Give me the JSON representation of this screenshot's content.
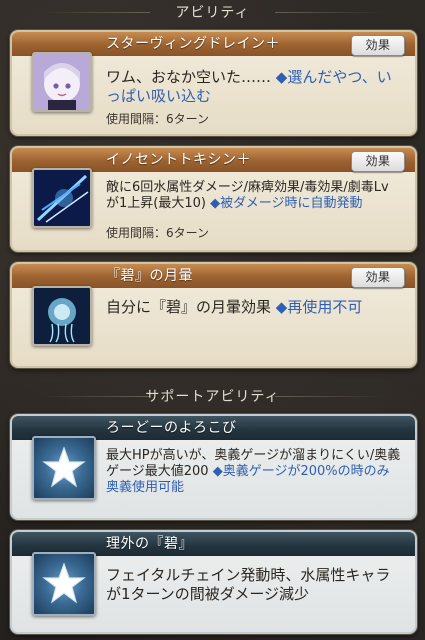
{
  "sections": {
    "abilities_title": "アビリティ",
    "support_title": "サポートアビリティ"
  },
  "abilities": [
    {
      "name": "スターヴィングドレイン＋",
      "badge": "効果",
      "desc_main": "ワム、おなか空いた……",
      "desc_hl": "◆選んだやつ、いっぱい吸い込む",
      "cooldown": "使用間隔：6ターン",
      "icon": "chibi-character-icon"
    },
    {
      "name": "イノセントトキシン＋",
      "badge": "効果",
      "desc_main": "敵に6回水属性ダメージ/麻痺効果/毒効果/劇毒Lvが1上昇(最大10)",
      "desc_hl": "◆被ダメージ時に自動発動",
      "cooldown": "使用間隔：6ターン",
      "icon": "water-slash-icon"
    },
    {
      "name": "『碧』の月暈",
      "badge": "効果",
      "desc_main": "自分に『碧』の月暈効果",
      "desc_hl": "◆再使用不可",
      "icon": "jellyfish-icon"
    }
  ],
  "supports": [
    {
      "name": "ろーどーのよろこび",
      "desc_main": "最大HPが高いが、奥義ゲージが溜まりにくい/奥義ゲージ最大値200",
      "desc_hl": "◆奥義ゲージが200%の時のみ奥義使用可能",
      "icon": "star-icon"
    },
    {
      "name": "理外の『碧』",
      "desc_main": "フェイタルチェイン発動時、水属性キャラが1ターンの間被ダメージ減少",
      "icon": "star-icon"
    }
  ],
  "colors": {
    "ability_header": "#9c6230",
    "support_header": "#253640",
    "highlight_text": "#2f5fb2"
  }
}
